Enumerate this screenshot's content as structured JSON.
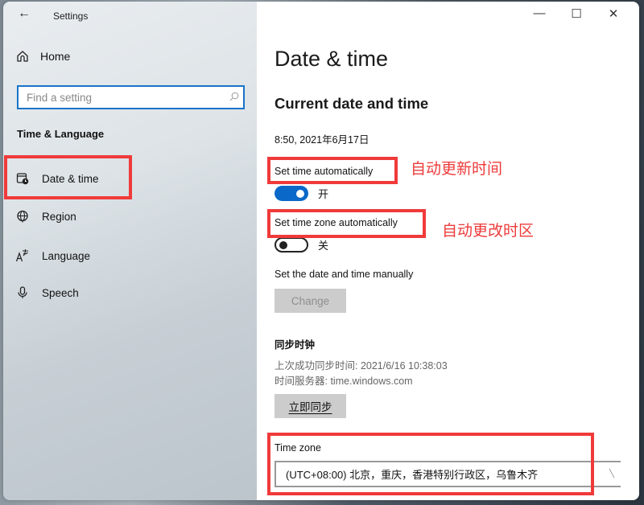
{
  "window": {
    "app_title": "Settings",
    "controls": {
      "minimize": "—",
      "maximize": "☐",
      "close": "✕"
    }
  },
  "sidebar": {
    "back_icon": "←",
    "home_label": "Home",
    "search_placeholder": "Find a setting",
    "search_icon": "⚲",
    "section_heading": "Time & Language",
    "items": [
      {
        "label": "Date & time",
        "icon": "calendar-clock-icon",
        "selected": true
      },
      {
        "label": "Region",
        "icon": "globe-icon"
      },
      {
        "label": "Language",
        "icon": "language-icon"
      },
      {
        "label": "Speech",
        "icon": "microphone-icon"
      }
    ]
  },
  "main": {
    "page_title": "Date & time",
    "subtitle": "Current date and time",
    "current_time": "8:50, 2021年6月17日",
    "set_time_auto": {
      "label": "Set time automatically",
      "state": "开",
      "on": true
    },
    "set_tz_auto": {
      "label": "Set time zone automatically",
      "state": "关",
      "on": false
    },
    "manual": {
      "label": "Set the date and time manually",
      "button": "Change"
    },
    "sync": {
      "heading": "同步时钟",
      "last_sync": "上次成功同步时间: 2021/6/16 10:38:03",
      "server": "时间服务器: time.windows.com",
      "button": "立即同步"
    },
    "timezone": {
      "label": "Time zone",
      "value": "(UTC+08:00) 北京，重庆，香港特别行政区，乌鲁木齐"
    }
  },
  "annotations": {
    "auto_time": "自动更新时间",
    "auto_tz": "自动更改时区",
    "color": "#f03a3a"
  },
  "colors": {
    "accent": "#0a68c8",
    "search_border": "#1a73c8"
  }
}
